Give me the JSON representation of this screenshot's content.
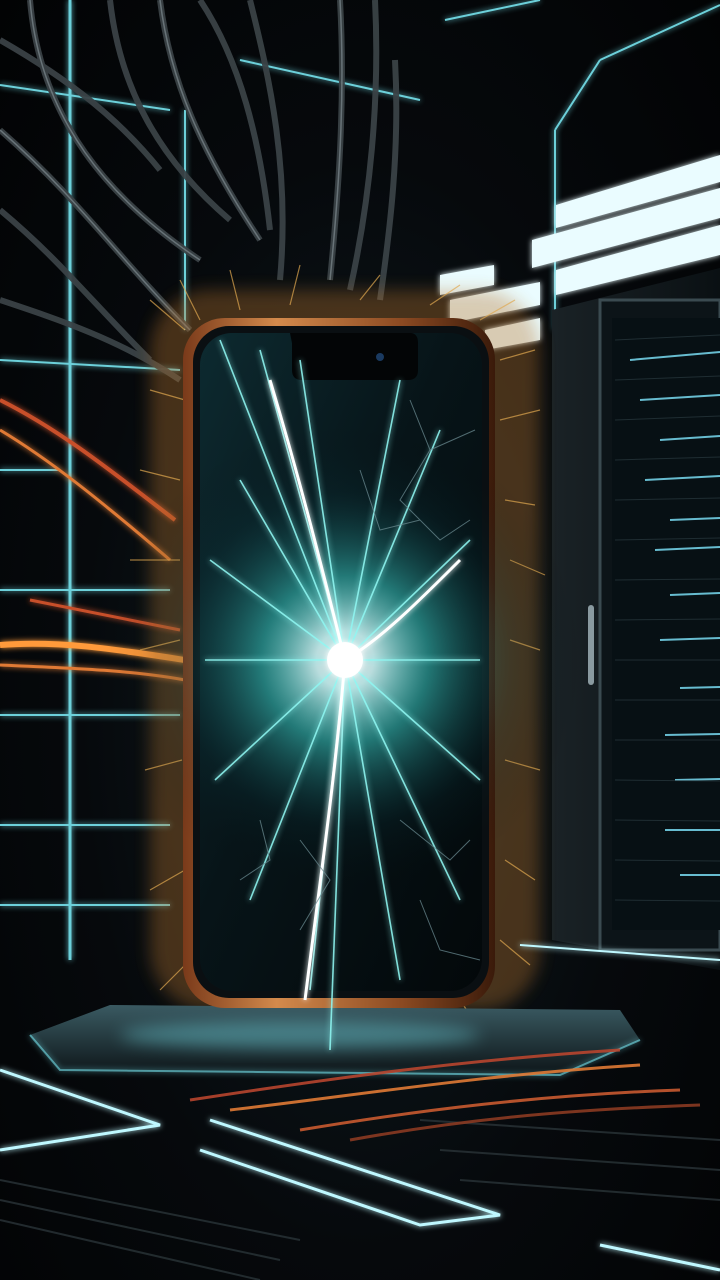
{
  "scene": {
    "subject": "smartphone-with-shattered-glowing-screen",
    "palette": {
      "background": "#05080b",
      "neon_cyan": "#7ff4ff",
      "energy_core": "#e8ffff",
      "energy_teal": "#3fe0d8",
      "fiber_orange": "#e88a2c",
      "fiber_gold": "#d9a44a",
      "phone_frame": "#c2703a",
      "wire_red": "#b8452e"
    }
  }
}
